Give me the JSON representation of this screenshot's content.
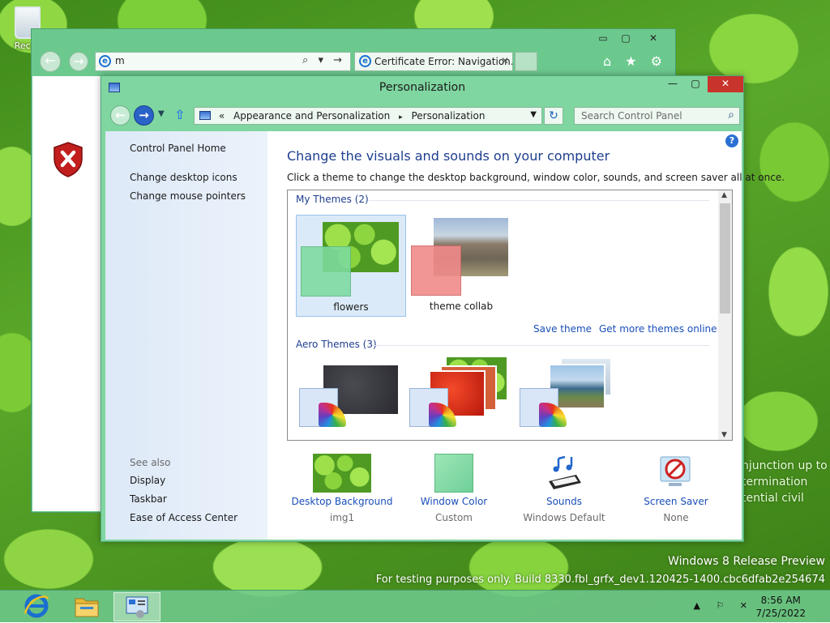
{
  "desktop": {
    "recycle_bin_label": "Recyc",
    "background_text": [
      "njunction up to",
      "termination",
      "tential civil"
    ],
    "watermark_line1": "Windows 8 Release Preview",
    "watermark_line2": "For testing purposes only. Build 8330.fbl_grfx_dev1.120425-1400.cbc6dfab2e254674"
  },
  "ie": {
    "address_value": "m",
    "tab_title": "Certificate Error: Navigation...",
    "address_tools": "⌕ ▾ →",
    "window_controls": {
      "min": "▭",
      "max": "▢",
      "close": "✕"
    },
    "right_icons": "⌂ ★ ⚙"
  },
  "cp": {
    "title": "Personalization",
    "window_controls": {
      "min": "—",
      "max": "▢",
      "close": "✕"
    },
    "breadcrumb": {
      "prefix": "«",
      "parent": "Appearance and Personalization",
      "separator": "▸",
      "current": "Personalization"
    },
    "search_placeholder": "Search Control Panel",
    "sidebar": {
      "home": "Control Panel Home",
      "links": [
        "Change desktop icons",
        "Change mouse pointers"
      ],
      "see_also_label": "See also",
      "see_also": [
        "Display",
        "Taskbar",
        "Ease of Access Center"
      ]
    },
    "heading": "Change the visuals and sounds on your computer",
    "subtitle": "Click a theme to change the desktop background, window color, sounds, and screen saver all at once.",
    "my_themes_label": "My Themes (2)",
    "my_themes": [
      {
        "name": "flowers",
        "selected": true,
        "accent": "#7ddba0"
      },
      {
        "name": "theme collab",
        "selected": false,
        "accent": "#f08a8a"
      }
    ],
    "save_theme": "Save theme",
    "get_more": "Get more themes online",
    "aero_themes_label": "Aero Themes (3)",
    "bottom": [
      {
        "name": "Desktop Background",
        "value": "img1"
      },
      {
        "name": "Window Color",
        "value": "Custom"
      },
      {
        "name": "Sounds",
        "value": "Windows Default"
      },
      {
        "name": "Screen Saver",
        "value": "None"
      }
    ]
  },
  "taskbar": {
    "time": "8:56 AM",
    "date": "7/25/2022"
  }
}
